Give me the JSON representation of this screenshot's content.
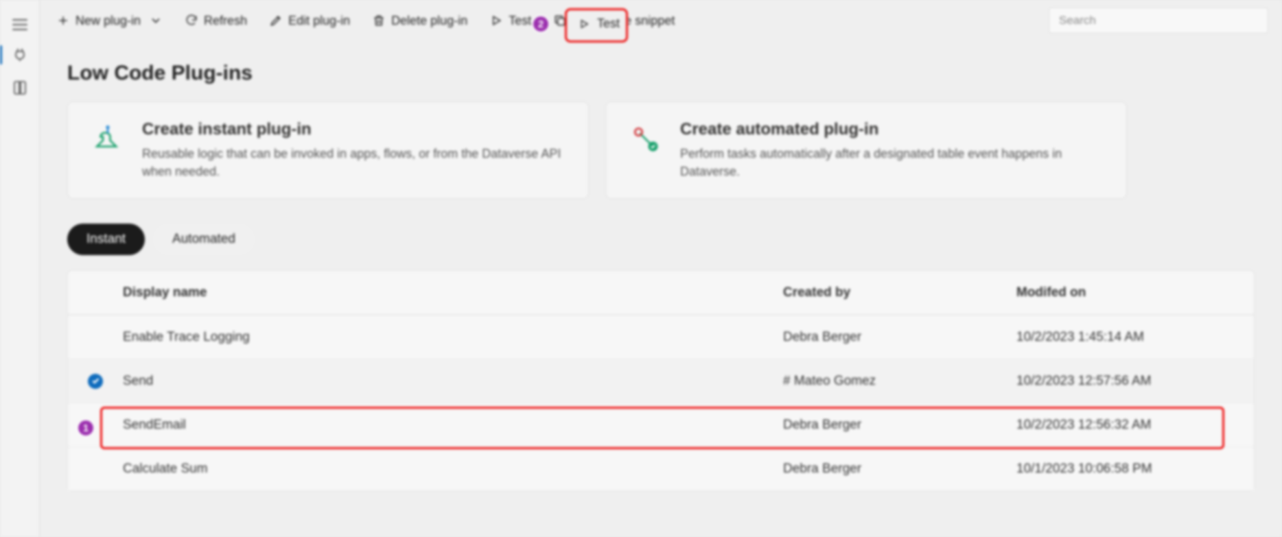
{
  "toolbar": {
    "new_label": "New plug-in",
    "refresh_label": "Refresh",
    "edit_label": "Edit plug-in",
    "delete_label": "Delete plug-in",
    "test_label": "Test",
    "copy_label": "Copy code snippet",
    "search_placeholder": "Search"
  },
  "page": {
    "title": "Low Code Plug-ins"
  },
  "cards": {
    "instant": {
      "title": "Create instant plug-in",
      "desc": "Reusable logic that can be invoked in apps, flows, or from the Dataverse API when needed."
    },
    "automated": {
      "title": "Create automated plug-in",
      "desc": "Perform tasks automatically after a designated table event happens in Dataverse."
    }
  },
  "tabs": {
    "instant": "Instant",
    "automated": "Automated"
  },
  "table": {
    "headers": {
      "name": "Display name",
      "by": "Created by",
      "mod": "Modifed on"
    },
    "rows": [
      {
        "name": "Enable Trace Logging",
        "by": "Debra Berger",
        "mod": "10/2/2023 1:45:14 AM",
        "selected": false
      },
      {
        "name": "Send",
        "by": "# Mateo Gomez",
        "mod": "10/2/2023 12:57:56 AM",
        "selected": true
      },
      {
        "name": "SendEmail",
        "by": "Debra Berger",
        "mod": "10/2/2023 12:56:32 AM",
        "selected": false
      },
      {
        "name": "Calculate Sum",
        "by": "Debra Berger",
        "mod": "10/1/2023 10:06:58 PM",
        "selected": false
      }
    ]
  },
  "annotations": {
    "step1": "1",
    "step2": "2"
  }
}
